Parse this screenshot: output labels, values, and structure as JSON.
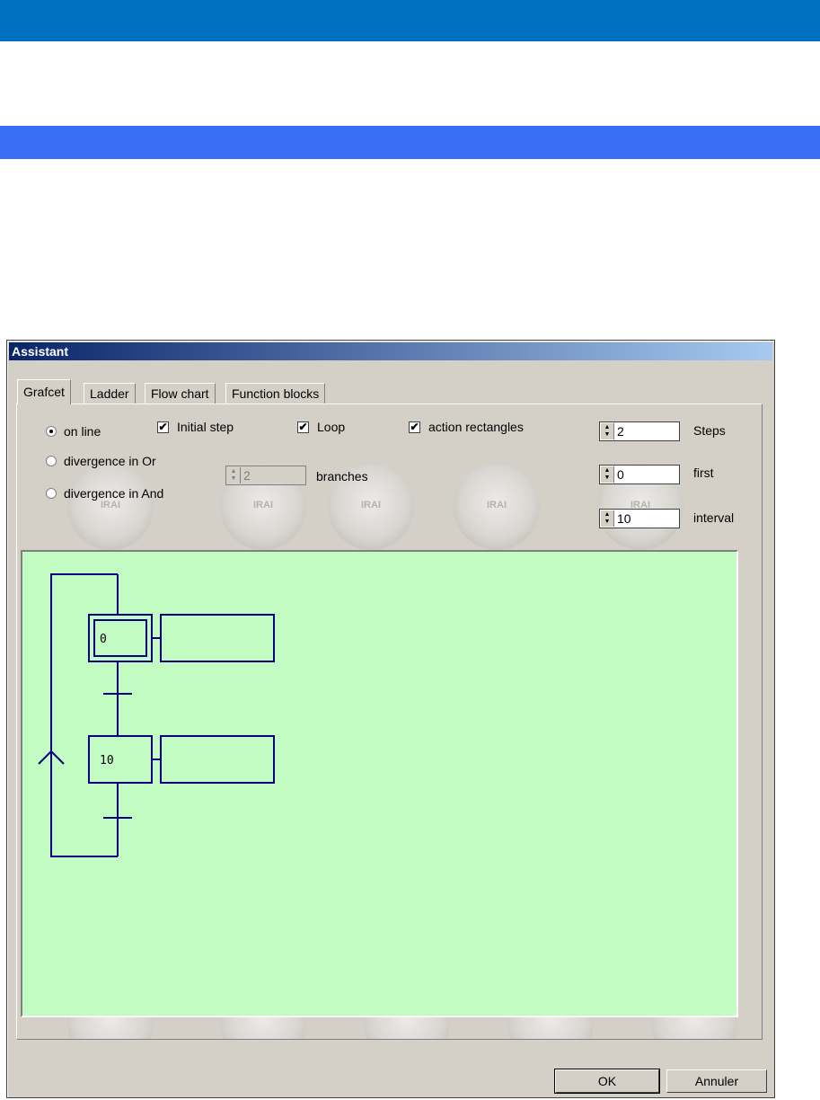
{
  "dialog": {
    "title": "Assistant"
  },
  "tabs": [
    {
      "label": "Grafcet",
      "active": true
    },
    {
      "label": "Ladder",
      "active": false
    },
    {
      "label": "Flow chart",
      "active": false
    },
    {
      "label": "Function blocks",
      "active": false
    }
  ],
  "options": {
    "layout": [
      {
        "label": "on line",
        "selected": true
      },
      {
        "label": "divergence in Or",
        "selected": false
      },
      {
        "label": "divergence in And",
        "selected": false
      }
    ],
    "initial_step": {
      "label": "Initial step",
      "checked": true
    },
    "loop": {
      "label": "Loop",
      "checked": true
    },
    "action_rectangles": {
      "label": "action rectangles",
      "checked": true
    },
    "branches": {
      "value": "2",
      "label": "branches",
      "enabled": false
    },
    "steps": {
      "value": "2",
      "label": "Steps"
    },
    "first": {
      "value": "0",
      "label": "first"
    },
    "interval": {
      "value": "10",
      "label": "interval"
    }
  },
  "preview": {
    "steps": [
      {
        "label": "0",
        "initial": true
      },
      {
        "label": "10",
        "initial": false
      }
    ],
    "background": "#c3fcc3",
    "line_color": "#000080"
  },
  "buttons": {
    "ok": "OK",
    "cancel": "Annuler"
  }
}
